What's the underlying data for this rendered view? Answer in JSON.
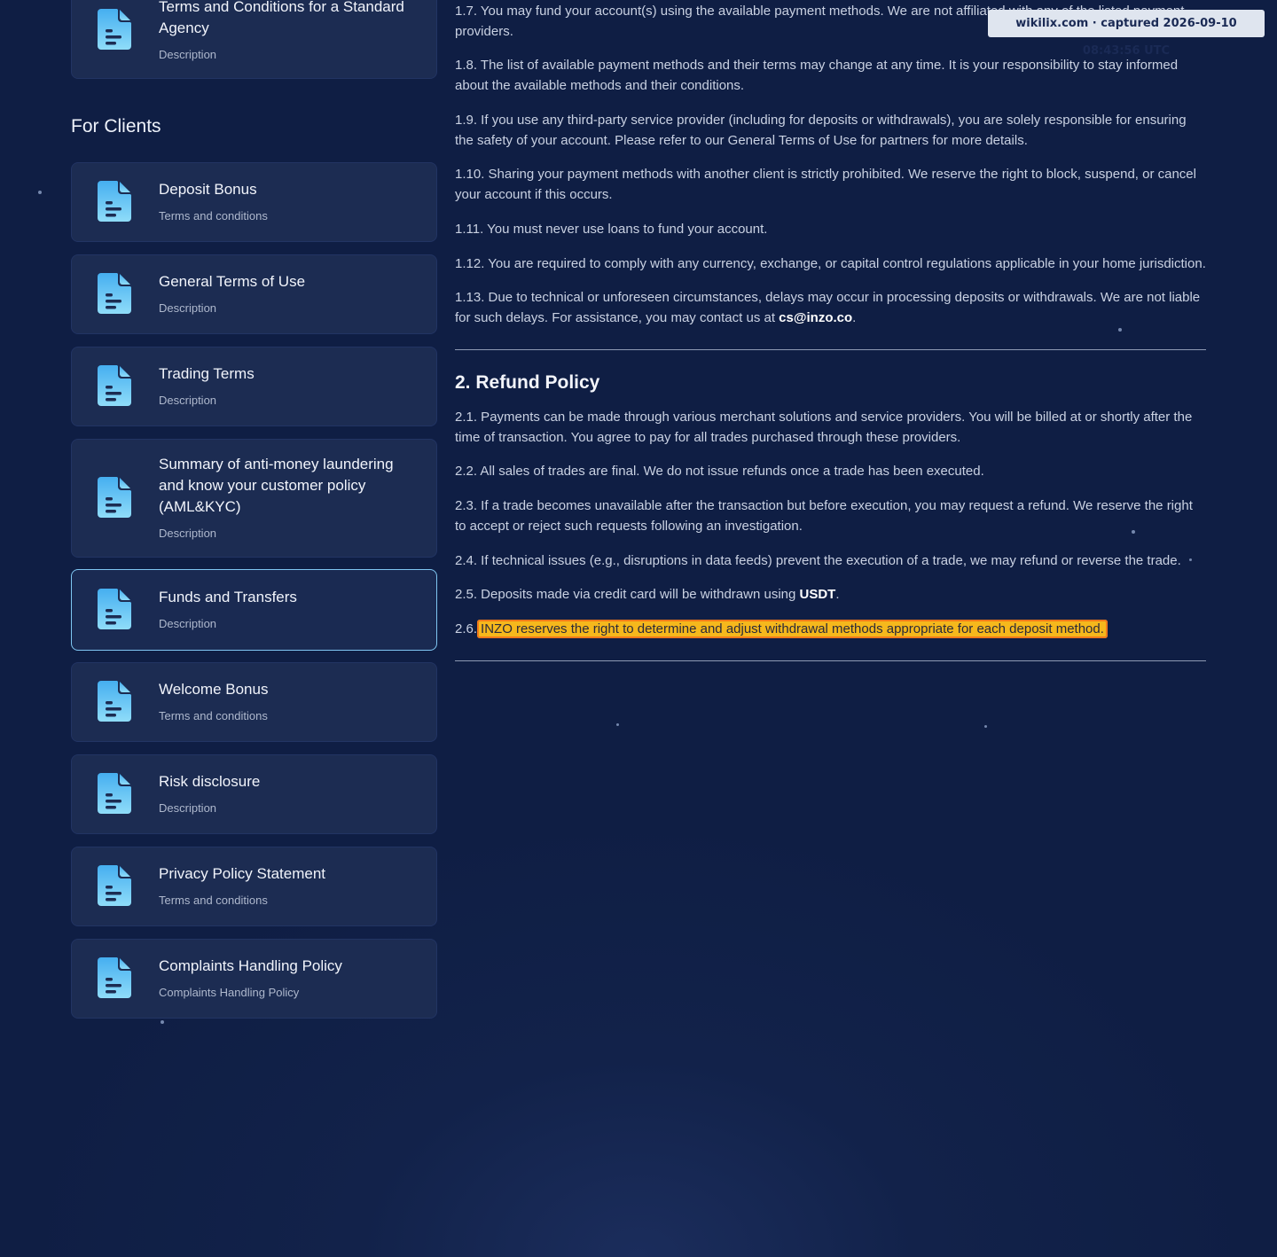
{
  "sidebar": {
    "top_card": {
      "title": "Terms and Conditions for a Standard Agency",
      "subtitle": "Description"
    },
    "section_heading": "For Clients",
    "items": [
      {
        "title": "Deposit Bonus",
        "subtitle": "Terms and conditions"
      },
      {
        "title": "General Terms of Use",
        "subtitle": "Description"
      },
      {
        "title": "Trading Terms",
        "subtitle": "Description"
      },
      {
        "title": "Summary of anti-money laundering and know your customer policy (AML&KYC)",
        "subtitle": "Description"
      },
      {
        "title": "Funds and Transfers",
        "subtitle": "Description",
        "active": true
      },
      {
        "title": "Welcome Bonus",
        "subtitle": "Terms and conditions"
      },
      {
        "title": "Risk disclosure",
        "subtitle": "Description"
      },
      {
        "title": "Privacy Policy Statement",
        "subtitle": "Terms and conditions"
      },
      {
        "title": "Complaints Handling Policy",
        "subtitle": "Complaints Handling Policy"
      }
    ]
  },
  "content": {
    "p1_7": "1.7. You may fund your account(s) using the available payment methods. We are not affiliated with any of the listed payment providers.",
    "p1_8": "1.8. The list of available payment methods and their terms may change at any time. It is your responsibility to stay informed about the available methods and their conditions.",
    "p1_9": "1.9. If you use any third-party service provider (including for deposits or withdrawals), you are solely responsible for ensuring the safety of your account. Please refer to our General Terms of Use for partners for more details.",
    "p1_10": "1.10. Sharing your payment methods with another client is strictly prohibited. We reserve the right to block, suspend, or cancel your account if this occurs.",
    "p1_11": "1.11. You must never use loans to fund your account.",
    "p1_12": "1.12. You are required to comply with any currency, exchange, or capital control regulations applicable in your home jurisdiction.",
    "p1_13_text": "1.13. Due to technical or unforeseen circumstances, delays may occur in processing deposits or withdrawals. We are not liable for such delays. For assistance, you may contact us at ",
    "p1_13_email": "cs@inzo.co",
    "p1_13_end": ".",
    "refund_heading": "2. Refund Policy",
    "p2_1": "2.1. Payments can be made through various merchant solutions and service providers. You will be billed at or shortly after the time of transaction. You agree to pay for all trades purchased through these providers.",
    "p2_2": "2.2. All sales of trades are final. We do not issue refunds once a trade has been executed.",
    "p2_3": "2.3. If a trade becomes unavailable after the transaction but before execution, you may request a refund. We reserve the right to accept or reject such requests following an investigation.",
    "p2_4": "2.4. If technical issues (e.g., disruptions in data feeds) prevent the execution of a trade, we may refund or reverse the trade.",
    "p2_5_text": "2.5. Deposits made via credit card will be withdrawn using ",
    "p2_5_bold": "USDT",
    "p2_5_end": ".",
    "p2_6_num": "2.6.",
    "p2_6_highlight": "INZO reserves the right to determine and adjust withdrawal methods appropriate for each deposit method."
  },
  "watermark": "wikilix.com · captured 2026-09-10 08:43:56 UTC",
  "colors": {
    "background": "#0f1e44",
    "card": "#1c2c52",
    "active_border": "#7fc6f2",
    "icon": "#4fb9f0",
    "highlight": "#f6b81c"
  },
  "icon_name": "document-icon"
}
